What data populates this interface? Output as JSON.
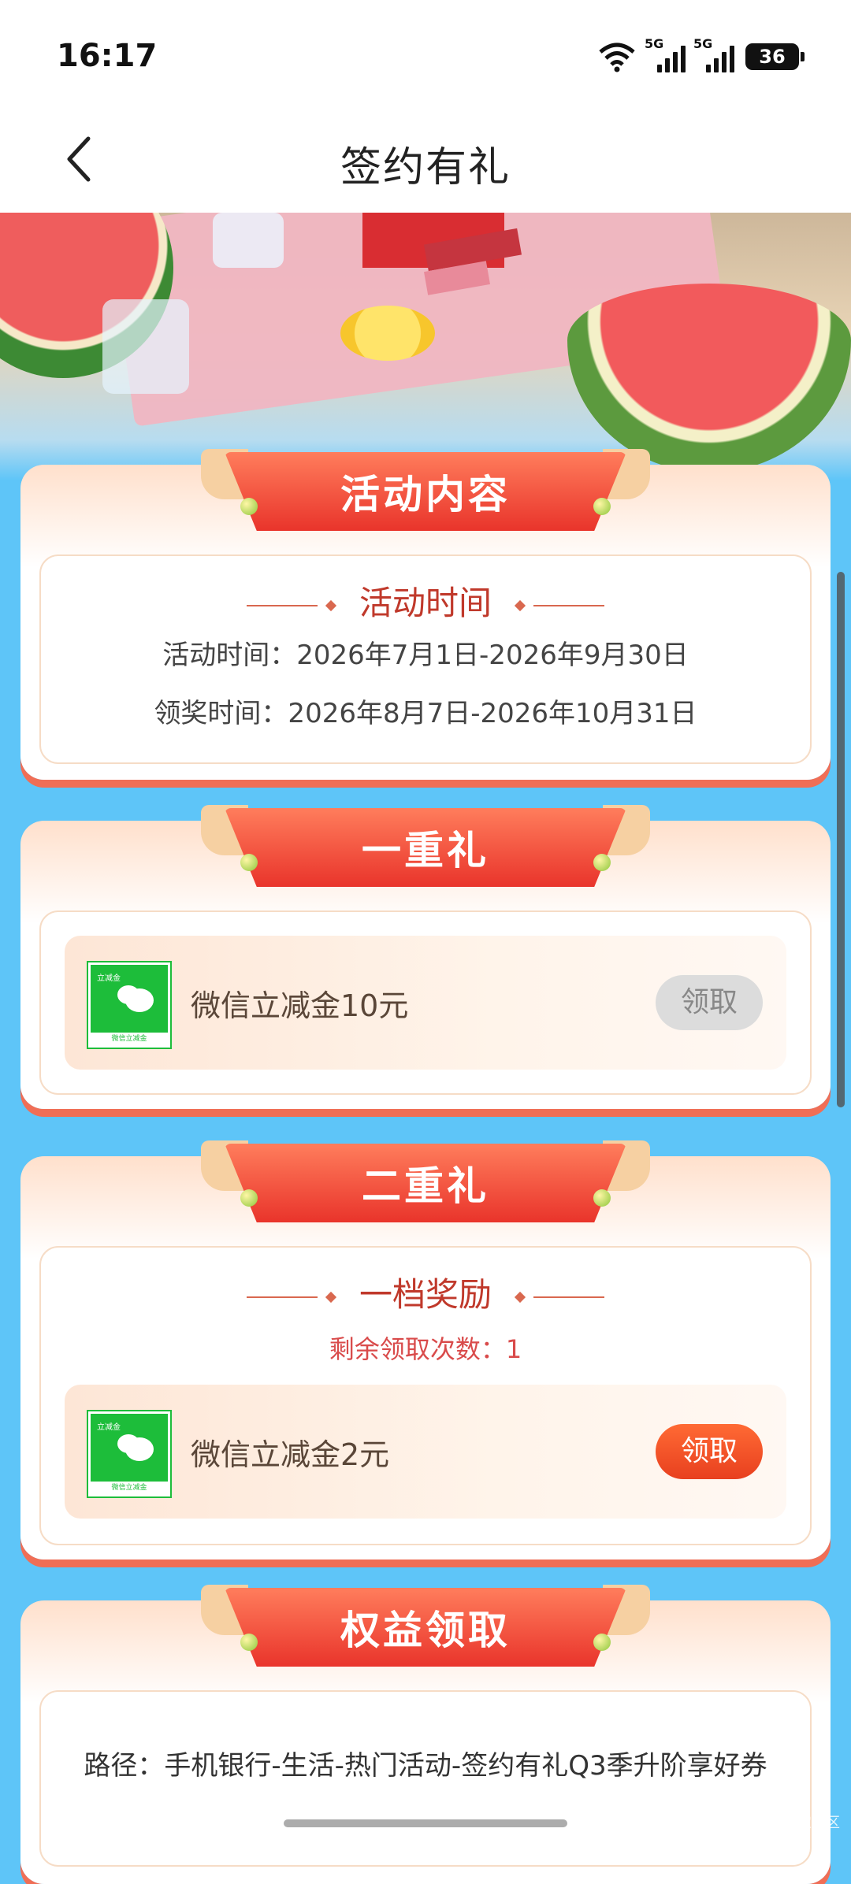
{
  "status_bar": {
    "time": "16:17",
    "signal1_label": "5G",
    "signal2_label": "5G",
    "battery": "36"
  },
  "nav": {
    "title": "签约有礼"
  },
  "section_activity": {
    "title": "活动内容",
    "sub_heading": "活动时间",
    "activity_time": "活动时间：2026年7月1日-2026年9月30日",
    "claim_time": "领奖时间：2026年8月7日-2026年10月31日"
  },
  "section_gift1": {
    "title": "一重礼",
    "reward_label": "微信立减金10元",
    "button": "领取",
    "icon_top": "立减金",
    "icon_caption": "微信立减金"
  },
  "section_gift2": {
    "title": "二重礼",
    "tier_heading": "一档奖励",
    "remaining": "剩余领取次数：1",
    "reward_label": "微信立减金2元",
    "button": "领取",
    "icon_top": "立减金",
    "icon_caption": "微信立减金"
  },
  "section_rights": {
    "title": "权益领取",
    "path": "路径：手机银行-生活-热门活动-签约有礼Q3季升阶享好券"
  },
  "watermark": "卡农社区"
}
